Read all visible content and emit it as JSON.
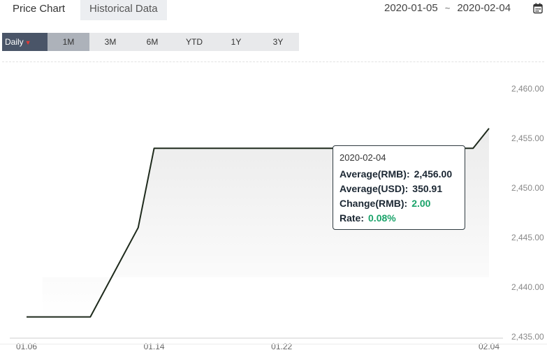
{
  "tabs": {
    "price_chart": "Price Chart",
    "historical_data": "Historical Data"
  },
  "date_range": {
    "start": "2020-01-05",
    "separator": "~",
    "end": "2020-02-04"
  },
  "periods": {
    "daily": "Daily",
    "items": [
      "1M",
      "3M",
      "6M",
      "YTD",
      "1Y",
      "3Y"
    ],
    "selected": "1M"
  },
  "tooltip": {
    "date": "2020-02-04",
    "average_rmb_label": "Average(RMB):",
    "average_rmb": "2,456.00",
    "average_usd_label": "Average(USD):",
    "average_usd": "350.91",
    "change_rmb_label": "Change(RMB):",
    "change_rmb": "2.00",
    "rate_label": "Rate:",
    "rate": "0.08%"
  },
  "colors": {
    "line": "#1e2a1c",
    "positive": "#1aa36a",
    "daily_bg": "#4a5568",
    "selected_bg": "#adb2ba"
  },
  "chart_data": {
    "type": "area",
    "x": [
      "2020-01-06",
      "2020-01-07",
      "2020-01-08",
      "2020-01-09",
      "2020-01-10",
      "2020-01-13",
      "2020-01-14",
      "2020-01-15",
      "2020-01-16",
      "2020-01-17",
      "2020-01-20",
      "2020-01-21",
      "2020-01-22",
      "2020-01-23",
      "2020-02-03",
      "2020-02-04"
    ],
    "x_ticks": [
      "01.06",
      "01.14",
      "01.22",
      "02.04"
    ],
    "y_ticks": [
      "2,460.00",
      "2,455.00",
      "2,450.00",
      "2,445.00",
      "2,440.00",
      "2,435.00"
    ],
    "ylim": [
      2435,
      2460
    ],
    "series": [
      {
        "values": [
          2437,
          2437,
          2437,
          2437,
          2437,
          2446,
          2454,
          2454,
          2454,
          2454,
          2454,
          2454,
          2454,
          2454,
          2454,
          2456
        ]
      }
    ],
    "grid": false
  }
}
